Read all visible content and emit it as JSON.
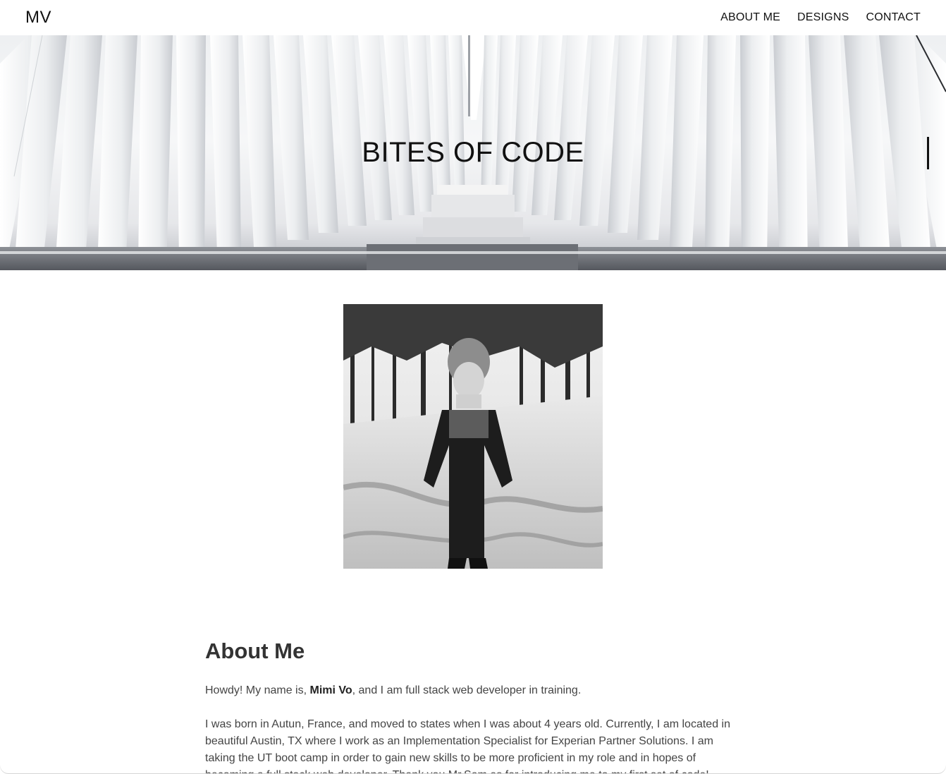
{
  "header": {
    "brand": "MV",
    "nav": [
      {
        "label": "ABOUT ME"
      },
      {
        "label": "DESIGNS"
      },
      {
        "label": "CONTACT"
      }
    ]
  },
  "hero": {
    "title": "BITES OF CODE",
    "image_icon": "architecture-hall-image"
  },
  "profile": {
    "photo_icon": "profile-photo-snow"
  },
  "about": {
    "heading": "About Me",
    "intro_before": "Howdy! My name is, ",
    "intro_name": "Mimi Vo",
    "intro_after": ", and I am full stack web developer in training.",
    "paragraph2": "I was born in Autun, France, and moved to states when I was about 4 years old. Currently, I am located in beautiful Austin, TX where I work as an Implementation Specialist for Experian Partner Solutions. I am taking the UT boot camp in order to gain new skills to be more proficient in my role and in hopes of becoming a full stack web developer. Thank you Mr.Sam as for introducing me to my first set of code!"
  },
  "colors": {
    "background": "#ffffff",
    "text": "#222222",
    "heading": "#333333"
  }
}
